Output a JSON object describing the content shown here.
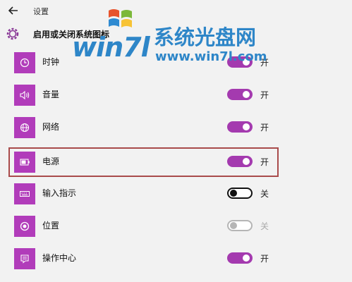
{
  "window": {
    "title": "设置"
  },
  "header": {
    "title": "启用或关闭系统图标"
  },
  "watermark": {
    "logo_text": "win7l",
    "cn_text": "系统光盘网",
    "url": "www.win7l.com"
  },
  "colors": {
    "accent": "#a43aaf",
    "tile": "#b13cba",
    "highlight": "#a94b4b",
    "background": "#f2f2f2"
  },
  "items": [
    {
      "label": "时钟",
      "icon": "clock-icon",
      "state": "开",
      "on": true
    },
    {
      "label": "音量",
      "icon": "volume-icon",
      "state": "开",
      "on": true
    },
    {
      "label": "网络",
      "icon": "network-icon",
      "state": "开",
      "on": true
    },
    {
      "label": "电源",
      "icon": "power-icon",
      "state": "开",
      "on": true
    },
    {
      "label": "输入指示",
      "icon": "keyboard-icon",
      "state": "关",
      "on": false
    },
    {
      "label": "位置",
      "icon": "location-icon",
      "state": "关",
      "on": false,
      "disabled": true
    },
    {
      "label": "操作中心",
      "icon": "action-center-icon",
      "state": "开",
      "on": true
    }
  ]
}
